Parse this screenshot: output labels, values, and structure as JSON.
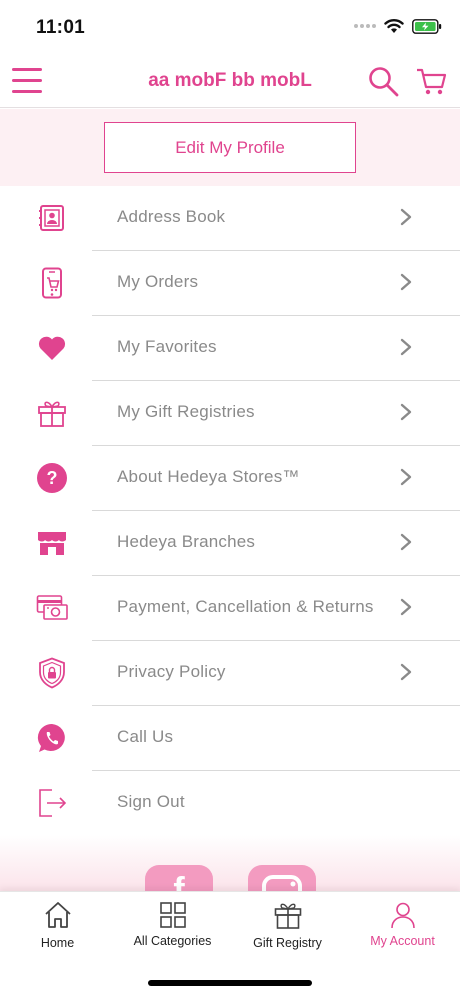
{
  "status_bar": {
    "time": "11:01"
  },
  "header": {
    "title": "aa mobF bb mobL"
  },
  "profile": {
    "edit_label": "Edit My Profile"
  },
  "menu": {
    "items": [
      {
        "label": "Address Book",
        "icon": "address-book-icon",
        "has_chevron": true
      },
      {
        "label": "My Orders",
        "icon": "orders-phone-icon",
        "has_chevron": true
      },
      {
        "label": "My Favorites",
        "icon": "heart-icon",
        "has_chevron": true
      },
      {
        "label": "My Gift Registries",
        "icon": "gift-icon",
        "has_chevron": true
      },
      {
        "label": "About Hedeya Stores™",
        "icon": "question-circle-icon",
        "has_chevron": true
      },
      {
        "label": "Hedeya Branches",
        "icon": "storefront-icon",
        "has_chevron": true
      },
      {
        "label": "Payment, Cancellation & Returns",
        "icon": "payment-cash-icon",
        "has_chevron": true
      },
      {
        "label": "Privacy Policy",
        "icon": "shield-lock-icon",
        "has_chevron": true
      },
      {
        "label": "Call Us",
        "icon": "phone-bubble-icon",
        "has_chevron": false
      },
      {
        "label": "Sign Out",
        "icon": "sign-out-icon",
        "has_chevron": false
      }
    ]
  },
  "social": [
    {
      "icon": "facebook-icon"
    },
    {
      "icon": "instagram-icon"
    }
  ],
  "tab_bar": {
    "tabs": [
      {
        "label": "Home",
        "icon": "home-icon",
        "active": false
      },
      {
        "label": "All Categories",
        "icon": "grid-icon",
        "active": false
      },
      {
        "label": "Gift Registry",
        "icon": "gift-icon",
        "active": false
      },
      {
        "label": "My Account",
        "icon": "user-icon",
        "active": true
      }
    ]
  },
  "colors": {
    "accent": "#e0448f",
    "label_gray": "#8a8a8a",
    "band_pink": "#fdf0f3"
  }
}
